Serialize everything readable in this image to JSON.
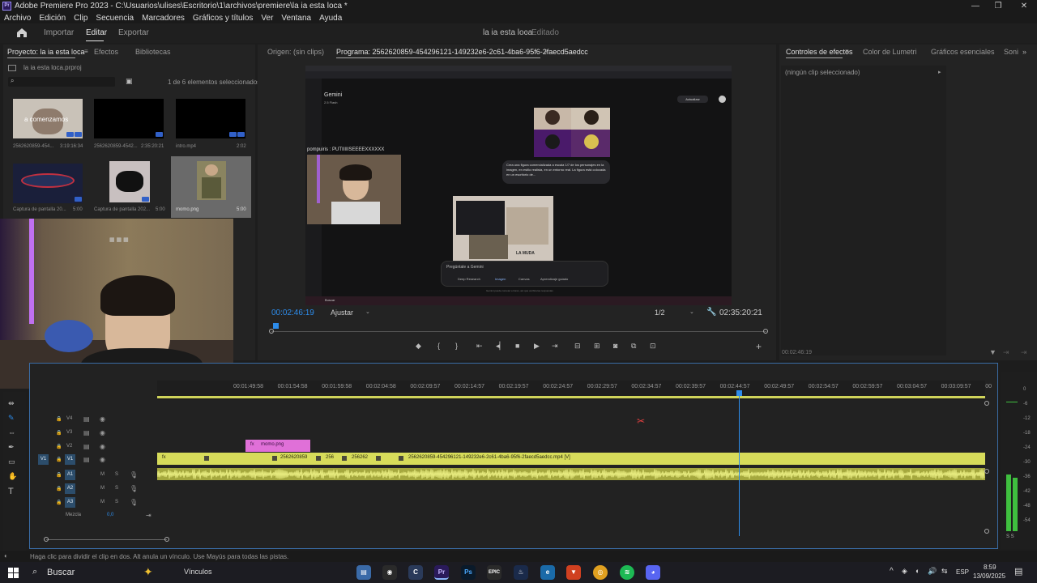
{
  "app": {
    "title": "Adobe Premiere Pro 2023 - C:\\Usuarios\\ulises\\Escritorio\\1\\archivos\\premiere\\la ia esta loca *",
    "logo": "Pr"
  },
  "menu": [
    "Archivo",
    "Edición",
    "Clip",
    "Secuencia",
    "Marcadores",
    "Gráficos y títulos",
    "Ver",
    "Ventana",
    "Ayuda"
  ],
  "workspace": {
    "tabs": [
      "Importar",
      "Editar",
      "Exportar"
    ],
    "active": "Editar",
    "project_name": "la ia esta loca",
    "status": "Editado"
  },
  "project_panel": {
    "tab_project": "Proyecto: la ia esta loca",
    "tab_effects": "Efectos",
    "tab_libraries": "Bibliotecas",
    "file": "la ia esta loca.prproj",
    "search_placeholder": "",
    "selection_count": "1 de 6 elementos seleccionados",
    "items": [
      {
        "name": "2562620859-454...",
        "duration": "3:19:16:34",
        "overlay": "a comenzamos"
      },
      {
        "name": "2562620859-4542...",
        "duration": "2:35:20:21"
      },
      {
        "name": "intro.mp4",
        "duration": "2:02"
      },
      {
        "name": "Captura de pantalla 20...",
        "duration": "5:00"
      },
      {
        "name": "Captura de pantalla 202...",
        "duration": "5:00"
      },
      {
        "name": "momo.png",
        "duration": "5:00"
      }
    ]
  },
  "source_monitor": {
    "tab": "Origen: (sin clips)"
  },
  "program_monitor": {
    "tab": "Programa: 2562620859-454296121-149232e6-2c61-4ba6-95f6-2faecd5aedcc",
    "current_time": "00:02:46:19",
    "fit": "Ajustar",
    "resolution": "1/2",
    "duration": "02:35:20:21",
    "content": {
      "app_name": "Gemini",
      "model": "2.5 Flash",
      "update_button": "Actualizar",
      "chat_user": "pompuiris : PUTIIIIISEEEEXXXXXX",
      "prompt_text": "Crea una figura comercializada a escala 1/7 de los personajes en la imagen, en estilo realista, en un entorno real. La figura está colocada en un escritorio de...",
      "ask_placeholder": "Pregúntale a Gemini",
      "tools": [
        "Deep Research",
        "Imagen",
        "Canvas",
        "Aprendizaje guiado"
      ],
      "figure_caption": "LA MUDA",
      "disclaimer": "Gemini puede cometer errores, así que verifica las respuestas",
      "taskbar_search": "Buscar"
    }
  },
  "effect_controls": {
    "tabs": [
      "Controles de efectos",
      "Color de Lumetri",
      "Gráficos esenciales",
      "Soni"
    ],
    "active": "Controles de efectos",
    "empty_text": "(ningún clip seleccionado)",
    "timecode": "00:02:46:19"
  },
  "timeline": {
    "ruler": [
      "00:01:49:58",
      "00:01:54:58",
      "00:01:59:58",
      "00:02:04:58",
      "00:02:09:57",
      "00:02:14:57",
      "00:02:19:57",
      "00:02:24:57",
      "00:02:29:57",
      "00:02:34:57",
      "00:02:39:57",
      "00:02:44:57",
      "00:02:49:57",
      "00:02:54:57",
      "00:02:59:57",
      "00:03:04:57",
      "00:03:09:57",
      "00"
    ],
    "video_tracks": [
      "V4",
      "V3",
      "V2",
      "V1"
    ],
    "audio_tracks": [
      "A1",
      "A2",
      "A3"
    ],
    "track_buttons": {
      "mute": "M",
      "solo": "S"
    },
    "mix_label": "Mezcla",
    "mix_value": "0,0",
    "clips": {
      "v2": "momo.png",
      "v1_a": "2562620859",
      "v1_b": "256",
      "v1_c": "256262",
      "v1_main": "2562620859-454296121-149232e6-2c61-4ba6-95f6-2faecd5aedcc.mp4 [V]"
    },
    "vu_scale": [
      "0",
      "-6",
      "-12",
      "-18",
      "-24",
      "-30",
      "-36",
      "-42",
      "-48",
      "-54"
    ],
    "vu_ss": "S S"
  },
  "status_bar": "Haga clic para dividir el clip en dos. Alt anula un vínculo. Use Mayús para todas las pistas.",
  "taskbar": {
    "search": "Buscar",
    "widget": "Vínculos",
    "lang": "ESP",
    "time": "8:59",
    "date": "13/09/2025"
  },
  "colors": {
    "accent_blue": "#2d8ceb",
    "clip_yellow": "#d7dc5a",
    "clip_pink": "#e070d8",
    "audio_green": "#a5a83e"
  }
}
